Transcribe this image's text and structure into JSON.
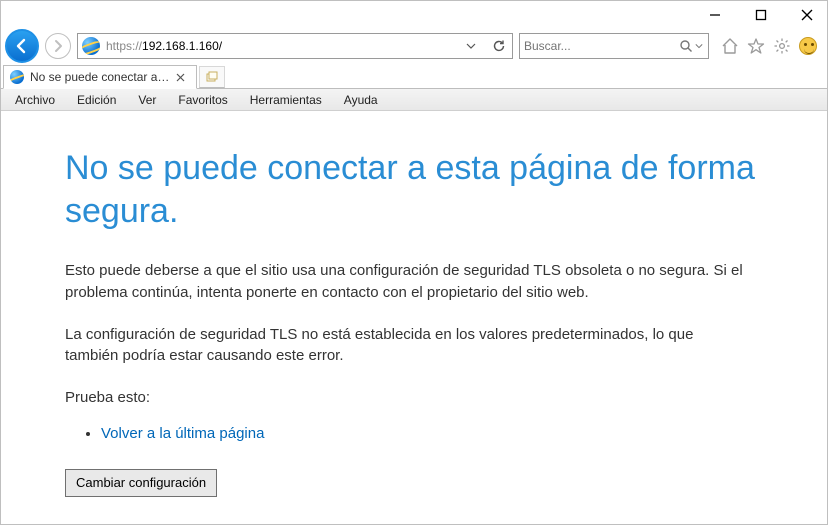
{
  "address": {
    "protocol": "https://",
    "rest": "192.168.1.160/"
  },
  "search": {
    "placeholder": "Buscar..."
  },
  "tab": {
    "title": "No se puede conectar a est..."
  },
  "menu": {
    "file": "Archivo",
    "edit": "Edición",
    "view": "Ver",
    "favorites": "Favoritos",
    "tools": "Herramientas",
    "help": "Ayuda"
  },
  "page": {
    "heading": "No se puede conectar a esta página de forma segura.",
    "p1": "Esto puede deberse a que el sitio usa una configuración de seguridad TLS obsoleta o no segura. Si el problema continúa, intenta ponerte en contacto con el propietario del sitio web.",
    "p2": "La configuración de seguridad TLS no está establecida en los valores predeterminados, lo que también podría estar causando este error.",
    "try_label": "Prueba esto:",
    "back_link": "Volver a la última página",
    "settings_btn": "Cambiar configuración"
  }
}
